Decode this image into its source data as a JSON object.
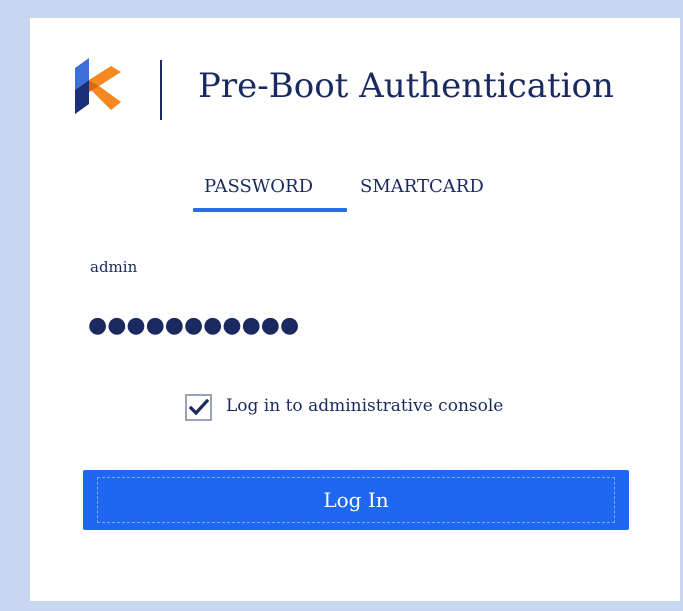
{
  "header": {
    "title": "Pre-Boot Authentication",
    "logo_icon": "brand-logo-icon"
  },
  "tabs": [
    {
      "label": "PASSWORD",
      "active": true
    },
    {
      "label": "SMARTCARD",
      "active": false
    }
  ],
  "form": {
    "username_value": "admin",
    "password_value": "●●●●●●●●●●●",
    "admin_console_checked": true,
    "admin_console_label": "Log in to administrative console",
    "login_button_label": "Log In"
  },
  "colors": {
    "accent": "#1f66f0",
    "text": "#1a2a5e",
    "frame": "#c9d6f2",
    "logo_orange": "#f5891f",
    "logo_blue": "#3c6fd8",
    "logo_navy": "#1d2f78"
  }
}
